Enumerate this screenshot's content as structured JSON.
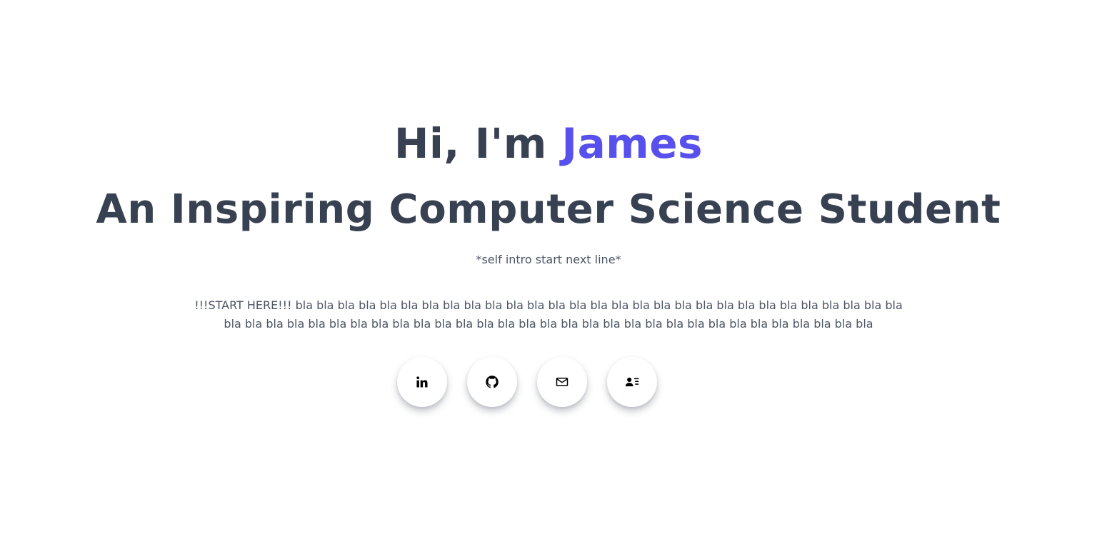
{
  "hero": {
    "greeting_prefix": "Hi, I'm ",
    "greeting_name": "James",
    "title": "An Inspiring Computer Science Student",
    "subtitle": "*self intro start next line*",
    "intro": "!!!START HERE!!! bla bla bla bla bla bla bla bla bla bla bla bla bla bla bla bla bla bla bla bla bla bla bla bla bla bla bla bla bla bla bla bla bla bla bla bla bla bla bla bla bla bla bla bla bla bla bla bla bla bla bla bla bla bla bla bla bla bla bla bla"
  },
  "colors": {
    "heading": "#374151",
    "accent": "#5850ec",
    "body_text": "#4b5563"
  },
  "social_links": [
    {
      "icon": "linkedin-icon"
    },
    {
      "icon": "github-icon"
    },
    {
      "icon": "mail-icon"
    },
    {
      "icon": "contact-card-icon"
    }
  ]
}
